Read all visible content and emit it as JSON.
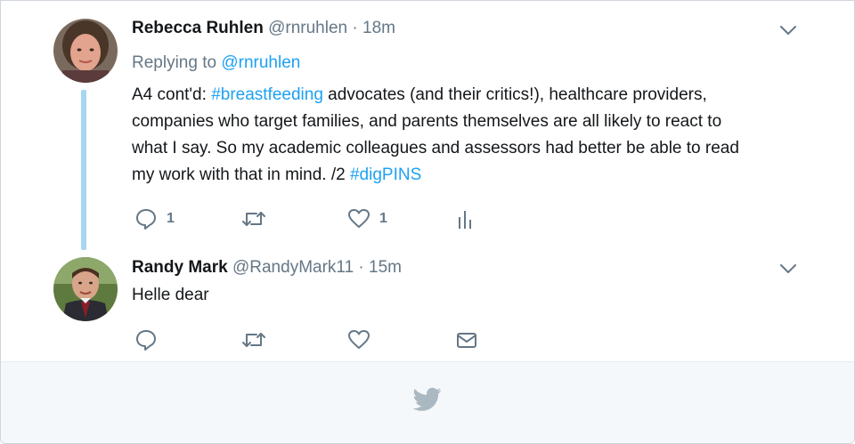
{
  "tweets": [
    {
      "name": "Rebecca Ruhlen",
      "handle": "@rnruhlen",
      "dot": "·",
      "time": "18m",
      "replying_prefix": "Replying to ",
      "replying_to": "@rnruhlen",
      "text_parts": [
        "A4 cont'd: ",
        "#breastfeeding",
        " advocates (and their critics!), healthcare providers,",
        "companies who target families, and parents themselves are all likely to react to",
        "what I say. So my academic colleagues and assessors had better be able to read",
        "my work with that in mind. /2 ",
        "#digPINS"
      ],
      "actions": {
        "reply_count": "1",
        "retweet_count": "",
        "like_count": "1"
      }
    },
    {
      "name": "Randy Mark",
      "handle": "@RandyMark11",
      "dot": "·",
      "time": "15m",
      "text": "Helle dear"
    }
  ],
  "colors": {
    "link": "#1da1f2",
    "secondary_text": "#657786",
    "thread_line": "#a7d6f0",
    "footer_bg": "#f5f8fa",
    "bird": "#aab8c2"
  },
  "icons": [
    "reply-icon",
    "retweet-icon",
    "like-icon",
    "analytics-icon",
    "direct-message-icon",
    "chevron-down-icon",
    "twitter-bird-icon"
  ]
}
